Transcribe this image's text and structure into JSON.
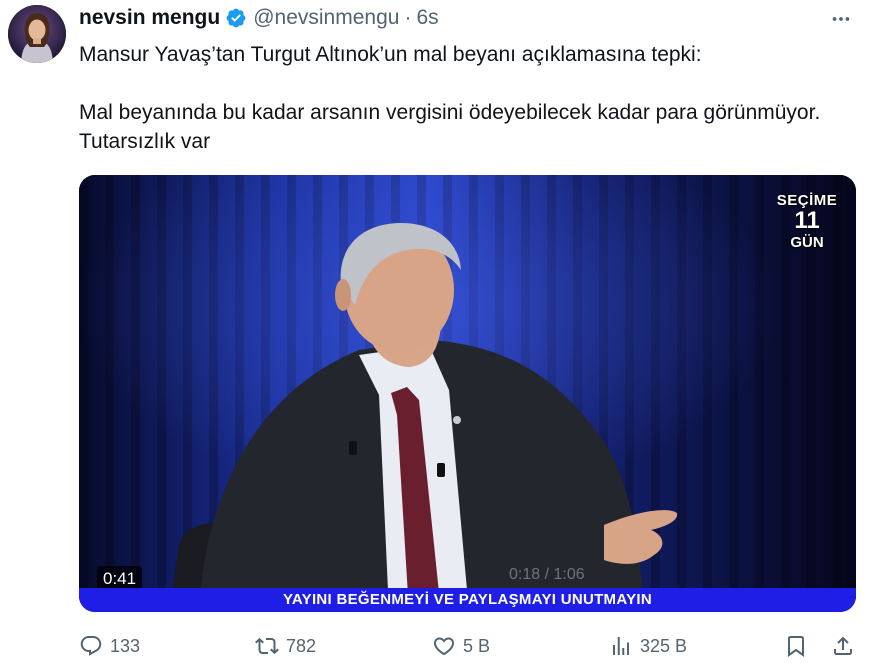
{
  "author": {
    "display_name": "nevsin mengu",
    "handle": "@nevsinmengu",
    "separator": "·",
    "time": "6s"
  },
  "tweet": {
    "line1": "Mansur Yavaş’tan Turgut Altınok’un mal beyanı açıklamasına tepki:",
    "line2": "Mal beyanında bu kadar arsanın vergisini ödeyebilecek kadar para görünmüyor. Tutarsızlık var"
  },
  "video": {
    "badge_line1": "SEÇİME",
    "badge_line2": "11",
    "badge_line3": "GÜN",
    "duration": "0:41",
    "banner": "YAYINI BEĞENMEYİ VE PAYLAŞMAYI UNUTMAYIN",
    "faint_overlay": "0:18 / 1:06"
  },
  "actions": {
    "replies": "133",
    "reposts": "782",
    "likes": "5 B",
    "views": "325 B"
  },
  "colors": {
    "text": "#0f1419",
    "secondary": "#536471",
    "verified": "#1d9bf0",
    "banner": "#1f1ee6"
  },
  "icons": [
    "verified-badge-icon",
    "more-icon",
    "reply-icon",
    "repost-icon",
    "like-icon",
    "views-icon",
    "bookmark-icon",
    "share-icon"
  ]
}
